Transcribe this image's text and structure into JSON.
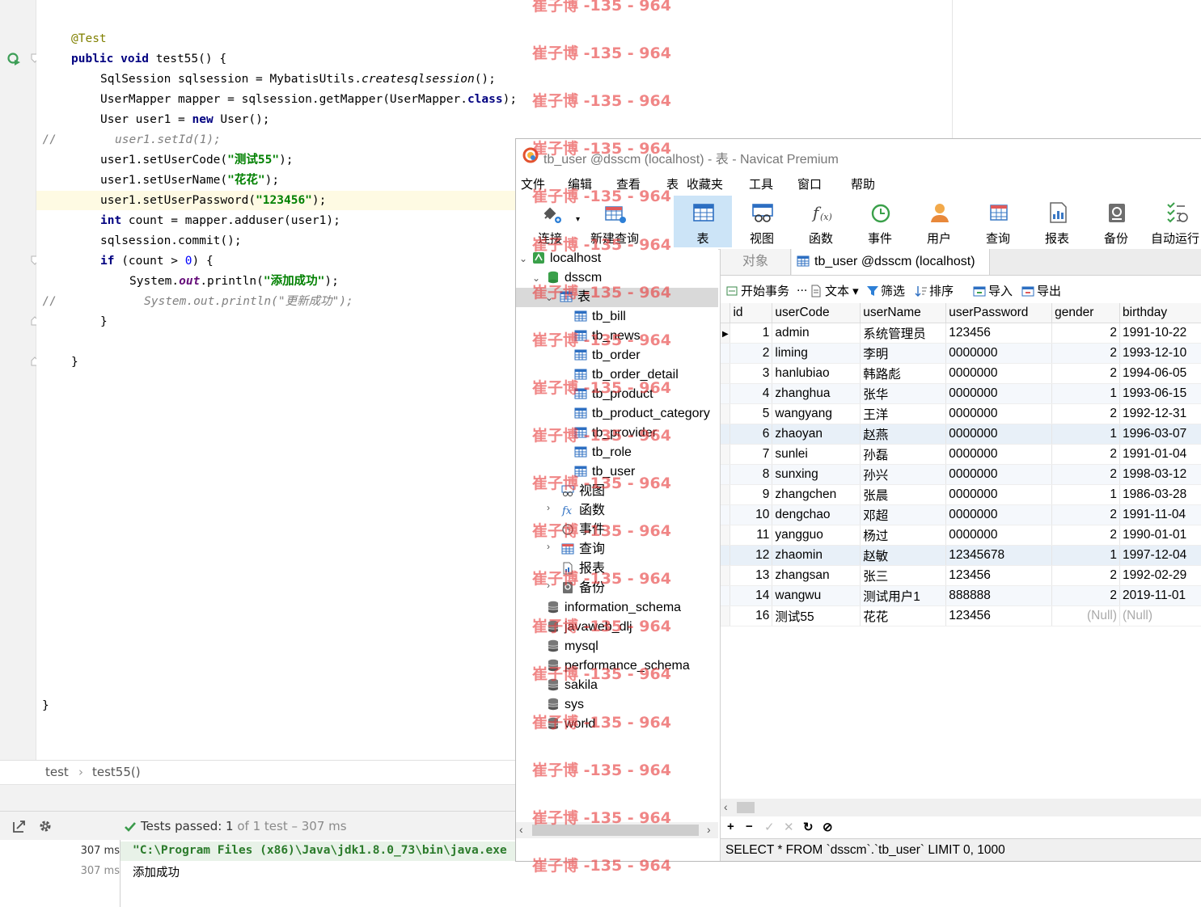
{
  "code": {
    "annotation": "@Test",
    "l1_kw": "public void",
    "l1_rest": " test55() {",
    "l2_a": "SqlSession sqlsession = MybatisUtils.",
    "l2_b": "createsqlsession",
    "l2_c": "();",
    "l3_a": "UserMapper mapper = sqlsession.getMapper(UserMapper.",
    "l3_kw": "class",
    "l3_c": ");",
    "l4_a": "User user1 = ",
    "l4_kw": "new",
    "l4_c": " User();",
    "l5_mark": "//",
    "l5_text": "user1.setId(1);",
    "l6_a": "user1.setUserCode(",
    "l6_s": "\"测试55\"",
    "l6_c": ");",
    "l7_a": "user1.setUserName(",
    "l7_s": "\"花花\"",
    "l7_c": ");",
    "l8_a": "user1.setUserPassword(",
    "l8_s": "\"123456\"",
    "l8_c": ");",
    "l9_kw": "int",
    "l9_c": " count = mapper.adduser(user1);",
    "l10": "sqlsession.commit();",
    "l11_kw": "if",
    "l11_a": " (count > ",
    "l11_num": "0",
    "l11_c": ") {",
    "l12_a": "System.",
    "l12_field": "out",
    "l12_b": ".println(",
    "l12_s": "\"添加成功\"",
    "l12_c": ");",
    "l13_mark": "//",
    "l13_text": "System.out.println(\"更新成功\");",
    "l14": "}",
    "l15": "}",
    "l16": "}"
  },
  "breadcrumb": {
    "item1": "test",
    "sep": "›",
    "item2": "test55()"
  },
  "test_bar": {
    "passed_label": "Tests passed: ",
    "passed_count": "1",
    "rest": " of 1 test – 307 ms"
  },
  "console": {
    "ms1": "307 ms",
    "ms2": "307 ms",
    "cmd": "\"C:\\Program Files (x86)\\Java\\jdk1.8.0_73\\bin\\java.exe",
    "out": "添加成功"
  },
  "navicat": {
    "title": "tb_user @dsscm (localhost) - 表 - Navicat Premium",
    "menu": [
      "文件",
      "编辑",
      "查看",
      "表",
      "收藏夹",
      "工具",
      "窗口",
      "帮助"
    ],
    "toolbar": [
      {
        "label": "连接",
        "icon": "plug-icon"
      },
      {
        "label": "新建查询",
        "icon": "new-query-icon"
      },
      {
        "label": "表",
        "icon": "table-icon"
      },
      {
        "label": "视图",
        "icon": "view-icon"
      },
      {
        "label": "函数",
        "icon": "function-icon"
      },
      {
        "label": "事件",
        "icon": "clock-icon"
      },
      {
        "label": "用户",
        "icon": "user-icon"
      },
      {
        "label": "查询",
        "icon": "query-icon"
      },
      {
        "label": "报表",
        "icon": "report-icon"
      },
      {
        "label": "备份",
        "icon": "backup-icon"
      },
      {
        "label": "自动运行",
        "icon": "auto-run-icon"
      }
    ],
    "tree": {
      "connection": "localhost",
      "database": "dsscm",
      "tables_folder": "表",
      "tables": [
        "tb_bill",
        "tb_news",
        "tb_order",
        "tb_order_detail",
        "tb_product",
        "tb_product_category",
        "tb_provider",
        "tb_role",
        "tb_user"
      ],
      "folders": [
        "视图",
        "函数",
        "事件",
        "查询",
        "报表",
        "备份"
      ],
      "other_dbs": [
        "information_schema",
        "javaweb_dlj",
        "mysql",
        "performance_schema",
        "sakila",
        "sys",
        "world"
      ]
    },
    "tabs": {
      "objects": "对象",
      "current": "tb_user @dsscm (localhost) ..."
    },
    "subtoolbar": {
      "begin": "开始事务",
      "text": "文本",
      "filter": "筛选",
      "sort": "排序",
      "import": "导入",
      "export": "导出"
    },
    "columns": [
      "id",
      "userCode",
      "userName",
      "userPassword",
      "gender",
      "birthday"
    ],
    "rows": [
      [
        "1",
        "admin",
        "系统管理员",
        "123456",
        "2",
        "1991-10-22"
      ],
      [
        "2",
        "liming",
        "李明",
        "0000000",
        "2",
        "1993-12-10"
      ],
      [
        "3",
        "hanlubiao",
        "韩路彪",
        "0000000",
        "2",
        "1994-06-05"
      ],
      [
        "4",
        "zhanghua",
        "张华",
        "0000000",
        "1",
        "1993-06-15"
      ],
      [
        "5",
        "wangyang",
        "王洋",
        "0000000",
        "2",
        "1992-12-31"
      ],
      [
        "6",
        "zhaoyan",
        "赵燕",
        "0000000",
        "1",
        "1996-03-07"
      ],
      [
        "7",
        "sunlei",
        "孙磊",
        "0000000",
        "2",
        "1991-01-04"
      ],
      [
        "8",
        "sunxing",
        "孙兴",
        "0000000",
        "2",
        "1998-03-12"
      ],
      [
        "9",
        "zhangchen",
        "张晨",
        "0000000",
        "1",
        "1986-03-28"
      ],
      [
        "10",
        "dengchao",
        "邓超",
        "0000000",
        "2",
        "1991-11-04"
      ],
      [
        "11",
        "yangguo",
        "杨过",
        "0000000",
        "2",
        "1990-01-01"
      ],
      [
        "12",
        "zhaomin",
        "赵敏",
        "12345678",
        "1",
        "1997-12-04"
      ],
      [
        "13",
        "zhangsan",
        "张三",
        "123456",
        "2",
        "1992-02-29"
      ],
      [
        "14",
        "wangwu",
        "测试用户1",
        "888888",
        "2",
        "2019-11-01"
      ],
      [
        "16",
        "测试55",
        "花花",
        "123456",
        "(Null)",
        "(Null)"
      ]
    ],
    "record_bar": {
      "add": "+",
      "remove": "−",
      "apply": "✓",
      "cancel": "✕",
      "refresh": "↻",
      "stop": "⊘"
    },
    "sql": "SELECT * FROM `dsscm`.`tb_user` LIMIT 0, 1000"
  },
  "watermark": "崔子博 -135 - 964"
}
